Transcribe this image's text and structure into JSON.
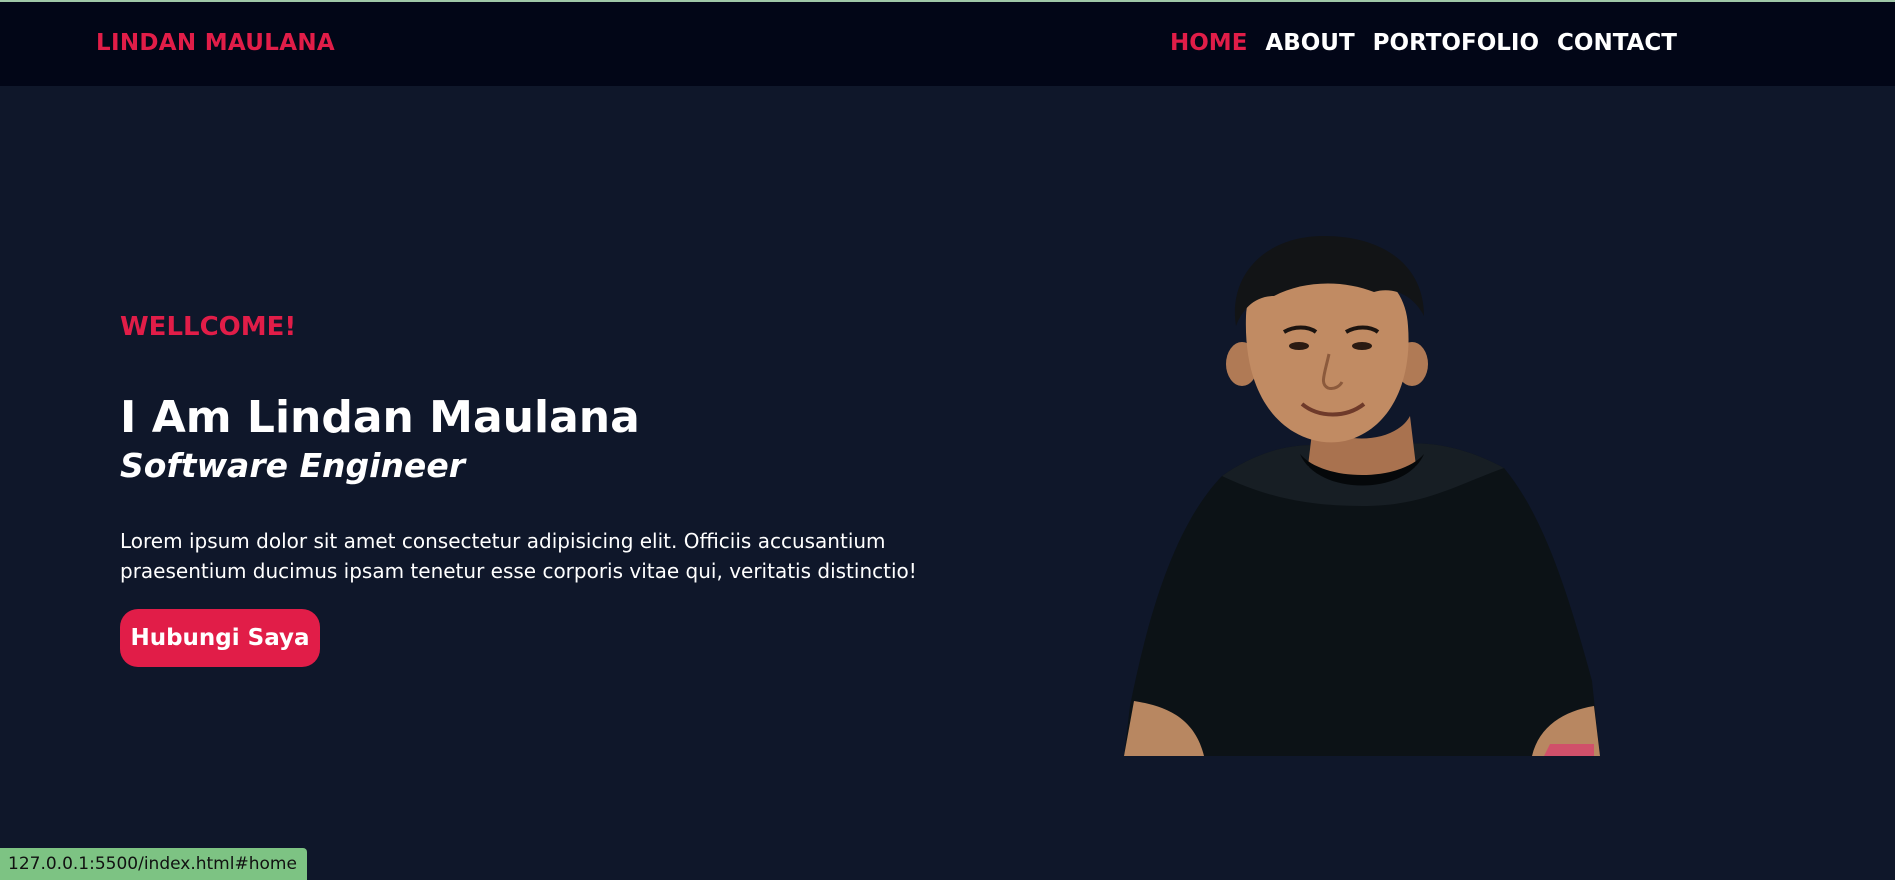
{
  "navbar": {
    "brand": "LINDAN MAULANA",
    "links": [
      {
        "label": "HOME",
        "active": true
      },
      {
        "label": "ABOUT",
        "active": false
      },
      {
        "label": "PORTOFOLIO",
        "active": false
      },
      {
        "label": "CONTACT",
        "active": false
      }
    ]
  },
  "hero": {
    "welcome": "WELLCOME!",
    "heading": "I Am Lindan Maulana",
    "role": "Software Engineer",
    "intro": "Lorem ipsum dolor sit amet consectetur adipisicing elit. Officiis accusantium praesentium ducimus ipsam tenetur esse corporis vitae qui, veritatis distinctio!",
    "cta_label": "Hubungi Saya"
  },
  "status_bar": {
    "url": "127.0.0.1:5500/index.html#home"
  },
  "colors": {
    "accent": "#e11d48",
    "background": "#0f172a",
    "navbar_bg": "#020617",
    "text": "#ffffff",
    "status_bar_bg": "#7dc383"
  }
}
